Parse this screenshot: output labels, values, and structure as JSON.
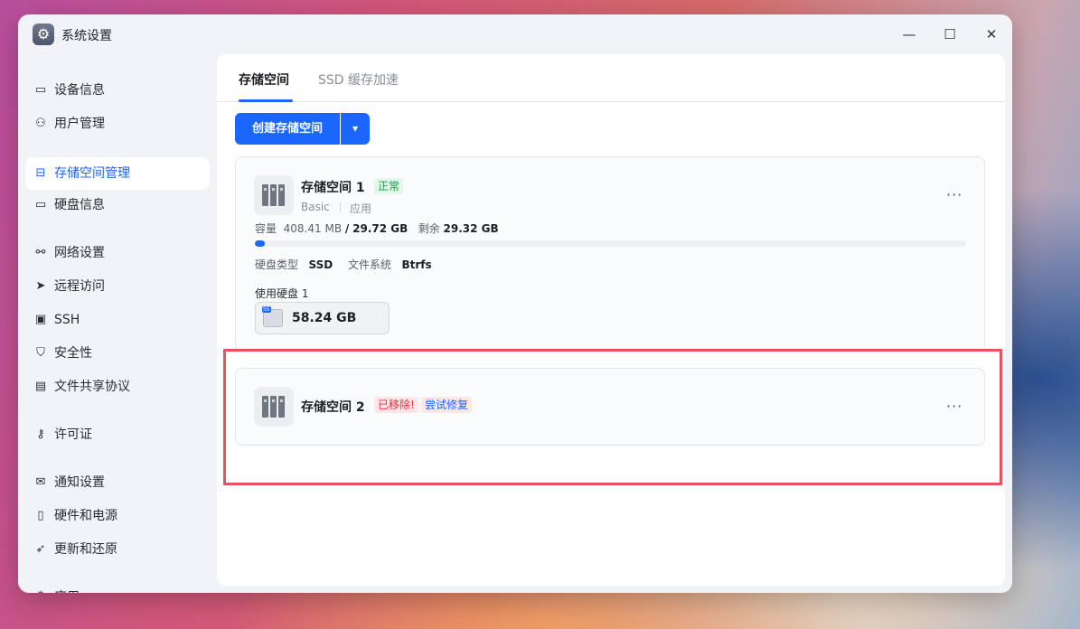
{
  "window": {
    "title": "系统设置",
    "icon": "gear-icon",
    "minimize": "—",
    "maximize": "☐",
    "close": "✕"
  },
  "sidebar": {
    "items": [
      {
        "label": "设备信息",
        "icon": "drive-icon"
      },
      {
        "label": "用户管理",
        "icon": "user-icon"
      },
      {
        "label": "存储空间管理",
        "icon": "inbox-icon",
        "active": true
      },
      {
        "label": "硬盘信息",
        "icon": "harddisk-icon"
      },
      {
        "label": "网络设置",
        "icon": "network-icon"
      },
      {
        "label": "远程访问",
        "icon": "send-icon"
      },
      {
        "label": "SSH",
        "icon": "terminal-icon"
      },
      {
        "label": "安全性",
        "icon": "shield-icon"
      },
      {
        "label": "文件共享协议",
        "icon": "document-icon"
      },
      {
        "label": "许可证",
        "icon": "key-icon"
      },
      {
        "label": "通知设置",
        "icon": "mail-icon"
      },
      {
        "label": "硬件和电源",
        "icon": "battery-icon"
      },
      {
        "label": "更新和还原",
        "icon": "rocket-icon"
      },
      {
        "label": "应用",
        "icon": "apps-icon"
      }
    ]
  },
  "tabs": [
    {
      "label": "存储空间",
      "active": true
    },
    {
      "label": "SSD 缓存加速",
      "active": false
    }
  ],
  "toolbar": {
    "create_label": "创建存储空间",
    "dropdown_icon": "chevron-down-icon"
  },
  "pools": [
    {
      "name": "存储空间 1",
      "status": "正常",
      "raid": "Basic",
      "purpose": "应用",
      "capacity_label": "容量",
      "used": "408.41 MB",
      "slash": "/",
      "total": "29.72 GB",
      "free_label": "剩余",
      "free": "29.32 GB",
      "usage_percent": 1.4,
      "disk_type_label": "硬盘类型",
      "disk_type": "SSD",
      "fs_label": "文件系统",
      "fs": "Btrfs",
      "disks_label": "使用硬盘 1",
      "disk_size": "58.24 GB",
      "more": "···"
    },
    {
      "name": "存储空间 2",
      "status": "已移除!",
      "repair_label": "尝试修复",
      "more": "···"
    }
  ],
  "colors": {
    "accent": "#1a66ff",
    "ok": "#1a9b4a",
    "error": "#e0303a",
    "highlight": "#e8525a"
  }
}
